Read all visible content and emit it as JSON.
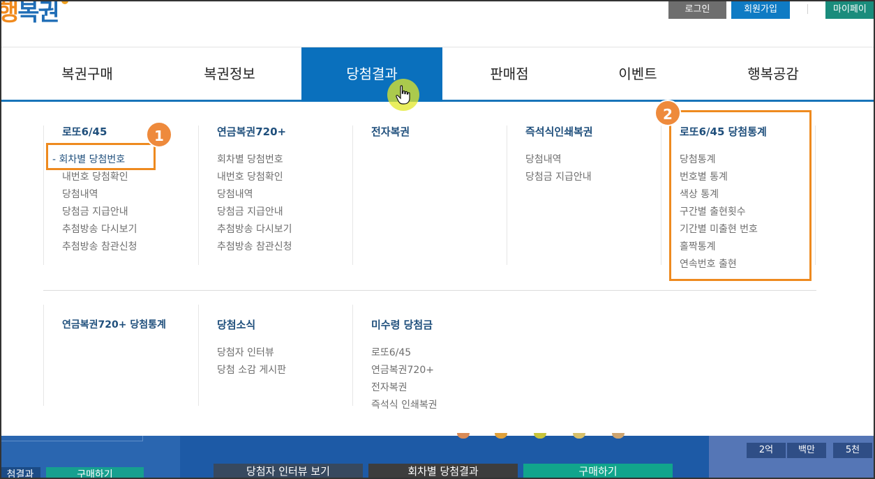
{
  "header": {
    "logo_part1": "행",
    "logo_part2": "복권",
    "login": "로그인",
    "join": "회원가입",
    "mypage": "마이페이"
  },
  "gnb": [
    "복권구매",
    "복권정보",
    "당첨결과",
    "판매점",
    "이벤트",
    "행복공감"
  ],
  "gnb_active": "당첨결과",
  "menu": {
    "lotto645": {
      "title": "로또6/45",
      "items": [
        "- 회차별 당첨번호",
        "내번호 당첨확인",
        "당첨내역",
        "당첨금 지급안내",
        "추첨방송 다시보기",
        "추첨방송 참관신청"
      ]
    },
    "pension720": {
      "title": "연금복권720+",
      "items": [
        "회차별 당첨번호",
        "내번호 당첨확인",
        "당첨내역",
        "당첨금 지급안내",
        "추첨방송 다시보기",
        "추첨방송 참관신청"
      ]
    },
    "elottery": {
      "title": "전자복권",
      "items": []
    },
    "instant": {
      "title": "즉석식인쇄복권",
      "items": [
        "당첨내역",
        "당첨금 지급안내"
      ]
    },
    "lotto_stats": {
      "title": "로또6/45 당첨통계",
      "items": [
        "당첨통계",
        "번호별 통계",
        "색상 통계",
        "구간별 출현횟수",
        "기간별 미출현 번호",
        "홀짝통계",
        "연속번호 출현"
      ]
    },
    "pension_stats": {
      "title": "연금복권720+ 당첨통계",
      "items": []
    },
    "news": {
      "title": "당첨소식",
      "items": [
        "당첨자 인터뷰",
        "당첨 소감 게시판"
      ]
    },
    "unclaimed": {
      "title": "미수령 당첨금",
      "items": [
        "로또6/45",
        "연금복권720+",
        "전자복권",
        "즉석식 인쇄복권"
      ]
    }
  },
  "annotations": {
    "badge1": "1",
    "badge2": "2"
  },
  "background": {
    "left_btn1": "첨결과",
    "left_btn2": "구매하기",
    "btn_interview": "당첨자 인터뷰 보기",
    "btn_results": "회차별 당첨결과",
    "btn_buy": "구매하기",
    "prize_tabs": [
      "2억",
      "백만",
      "5천"
    ]
  },
  "colors": {
    "accent": "#0a70bd",
    "highlight": "#ee8a1f",
    "menu_title": "#1f4f7c"
  }
}
